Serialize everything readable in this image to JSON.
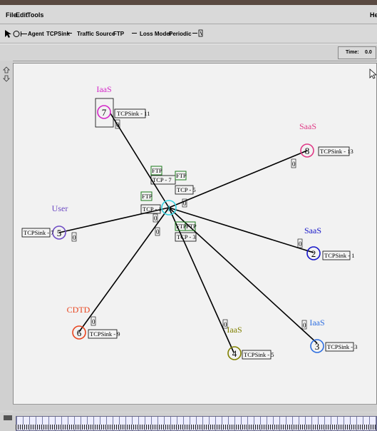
{
  "menu": {
    "file": "File",
    "edit": "Edit",
    "tools": "Tools",
    "help": "Help"
  },
  "toolbar": {
    "agent_label": "Agent",
    "agent_value": "TCPSink",
    "traffic_label": "Traffic Source",
    "traffic_value": "FTP",
    "loss_label": "Loss Model",
    "loss_value": "Periodic"
  },
  "timebar": {
    "time_label": "Time:",
    "time_value": "0.0"
  },
  "nodes": [
    {
      "id": "1",
      "label": "",
      "color": "#35d2e0"
    },
    {
      "id": "2",
      "label": "SaaS",
      "color": "#1515c8"
    },
    {
      "id": "3",
      "label": "IaaS",
      "color": "#2f6fe0"
    },
    {
      "id": "4",
      "label": "IaaS",
      "color": "#808000"
    },
    {
      "id": "5",
      "label": "User",
      "color": "#6e4cc4"
    },
    {
      "id": "6",
      "label": "CDTD",
      "color": "#e8451f"
    },
    {
      "id": "7",
      "label": "IaaS",
      "color": "#d428c8"
    },
    {
      "id": "8",
      "label": "SaaS",
      "color": "#e03a86"
    }
  ],
  "sinks": {
    "s11": "TCPSink - 11",
    "s13": "TCPSink - 13",
    "s7": "TCPSink - 7",
    "s1": "TCPSink - 1",
    "s9": "TCPSink - 9",
    "s5": "TCPSink - 5",
    "s3": "TCPSink - 3"
  },
  "agents": {
    "ftp_a": "FTP",
    "tcp_a": "TCP - 7",
    "ftp_b": "FTP",
    "tcp_b": "TCP - 5",
    "ftp_c": "FTP",
    "tcp_c": "TCP - 1",
    "ftp_d": "FTP",
    "ftp_e": "FTP",
    "tcp_d": "TCP - 3",
    "q": "0"
  }
}
